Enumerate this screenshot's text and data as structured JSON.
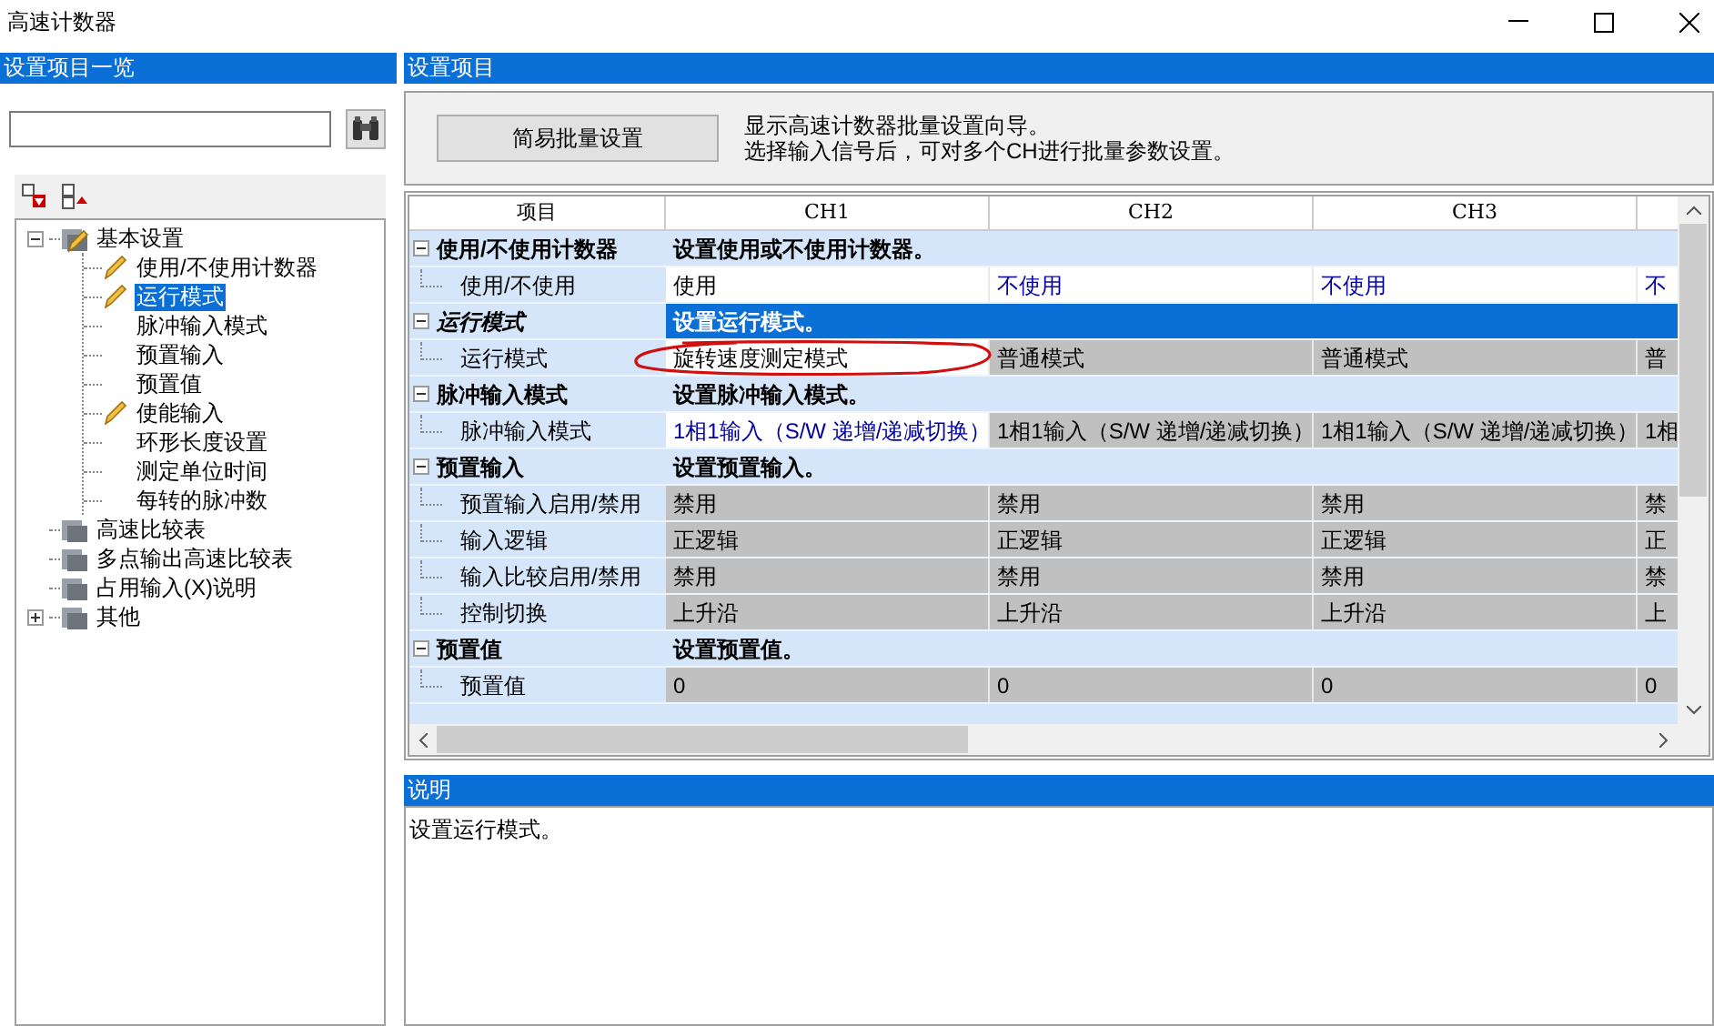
{
  "window": {
    "title": "高速计数器"
  },
  "sidebar": {
    "title": "设置项目一览",
    "tree": [
      {
        "label": "基本设置",
        "expanded": true,
        "edited": true,
        "selected": false,
        "children": [
          {
            "label": "使用/不使用计数器",
            "edited": true,
            "selected": false
          },
          {
            "label": "运行模式",
            "edited": true,
            "selected": true
          },
          {
            "label": "脉冲输入模式",
            "edited": false,
            "selected": false
          },
          {
            "label": "预置输入",
            "edited": false,
            "selected": false
          },
          {
            "label": "预置值",
            "edited": false,
            "selected": false
          },
          {
            "label": "使能输入",
            "edited": true,
            "selected": false
          },
          {
            "label": "环形长度设置",
            "edited": false,
            "selected": false
          },
          {
            "label": "测定单位时间",
            "edited": false,
            "selected": false
          },
          {
            "label": "每转的脉冲数",
            "edited": false,
            "selected": false
          }
        ]
      },
      {
        "label": "高速比较表",
        "edited": false,
        "selected": false
      },
      {
        "label": "多点输出高速比较表",
        "edited": false,
        "selected": false
      },
      {
        "label": "占用输入(X)说明",
        "edited": false,
        "selected": false
      },
      {
        "label": "其他",
        "expanded": false,
        "edited": false,
        "selected": false
      }
    ]
  },
  "settings": {
    "title": "设置项目",
    "batch_button": "简易批量设置",
    "batch_hint": [
      "显示高速计数器批量设置向导。",
      "选择输入信号后，可对多个CH进行批量参数设置。"
    ],
    "table": {
      "columns": [
        "项目",
        "CH1",
        "CH2",
        "CH3",
        ""
      ],
      "rows": [
        {
          "kind": "section",
          "label": "使用/不使用计数器",
          "description": "设置使用或不使用计数器。",
          "selected": false
        },
        {
          "kind": "item",
          "label": "使用/不使用",
          "cells": [
            {
              "text": "使用",
              "disabled": false,
              "changed": false
            },
            {
              "text": "不使用",
              "disabled": false,
              "changed": true
            },
            {
              "text": "不使用",
              "disabled": false,
              "changed": true
            },
            {
              "text": "不",
              "disabled": false,
              "changed": true
            }
          ]
        },
        {
          "kind": "section",
          "label": "运行模式",
          "description": "设置运行模式。",
          "selected": true
        },
        {
          "kind": "item",
          "label": "运行模式",
          "cells": [
            {
              "text": "旋转速度测定模式",
              "disabled": false,
              "changed": false
            },
            {
              "text": "普通模式",
              "disabled": true,
              "changed": false
            },
            {
              "text": "普通模式",
              "disabled": true,
              "changed": false
            },
            {
              "text": "普",
              "disabled": true,
              "changed": false
            }
          ]
        },
        {
          "kind": "section",
          "label": "脉冲输入模式",
          "description": "设置脉冲输入模式。",
          "selected": false
        },
        {
          "kind": "item",
          "label": "脉冲输入模式",
          "cells": [
            {
              "text": "1相1输入（S/W 递增/递减切换）",
              "disabled": false,
              "changed": true
            },
            {
              "text": "1相1输入（S/W 递增/递减切换）",
              "disabled": true,
              "changed": false
            },
            {
              "text": "1相1输入（S/W 递增/递减切换）",
              "disabled": true,
              "changed": false
            },
            {
              "text": "1相",
              "disabled": true,
              "changed": false
            }
          ]
        },
        {
          "kind": "section",
          "label": "预置输入",
          "description": "设置预置输入。",
          "selected": false
        },
        {
          "kind": "item",
          "label": "预置输入启用/禁用",
          "cells": [
            {
              "text": "禁用",
              "disabled": true,
              "changed": false
            },
            {
              "text": "禁用",
              "disabled": true,
              "changed": false
            },
            {
              "text": "禁用",
              "disabled": true,
              "changed": false
            },
            {
              "text": "禁",
              "disabled": true,
              "changed": false
            }
          ]
        },
        {
          "kind": "item",
          "label": "输入逻辑",
          "cells": [
            {
              "text": "正逻辑",
              "disabled": true,
              "changed": false
            },
            {
              "text": "正逻辑",
              "disabled": true,
              "changed": false
            },
            {
              "text": "正逻辑",
              "disabled": true,
              "changed": false
            },
            {
              "text": "正",
              "disabled": true,
              "changed": false
            }
          ]
        },
        {
          "kind": "item",
          "label": "输入比较启用/禁用",
          "cells": [
            {
              "text": "禁用",
              "disabled": true,
              "changed": false
            },
            {
              "text": "禁用",
              "disabled": true,
              "changed": false
            },
            {
              "text": "禁用",
              "disabled": true,
              "changed": false
            },
            {
              "text": "禁",
              "disabled": true,
              "changed": false
            }
          ]
        },
        {
          "kind": "item",
          "label": "控制切换",
          "cells": [
            {
              "text": "上升沿",
              "disabled": true,
              "changed": false
            },
            {
              "text": "上升沿",
              "disabled": true,
              "changed": false
            },
            {
              "text": "上升沿",
              "disabled": true,
              "changed": false
            },
            {
              "text": "上",
              "disabled": true,
              "changed": false
            }
          ]
        },
        {
          "kind": "section",
          "label": "预置值",
          "description": "设置预置值。",
          "selected": false
        },
        {
          "kind": "item",
          "label": "预置值",
          "cells": [
            {
              "text": "0",
              "disabled": true,
              "changed": false
            },
            {
              "text": "0",
              "disabled": true,
              "changed": false
            },
            {
              "text": "0",
              "disabled": true,
              "changed": false
            },
            {
              "text": "0",
              "disabled": true,
              "changed": false
            }
          ]
        }
      ]
    }
  },
  "description": {
    "title": "说明",
    "text": "设置运行模式。"
  }
}
